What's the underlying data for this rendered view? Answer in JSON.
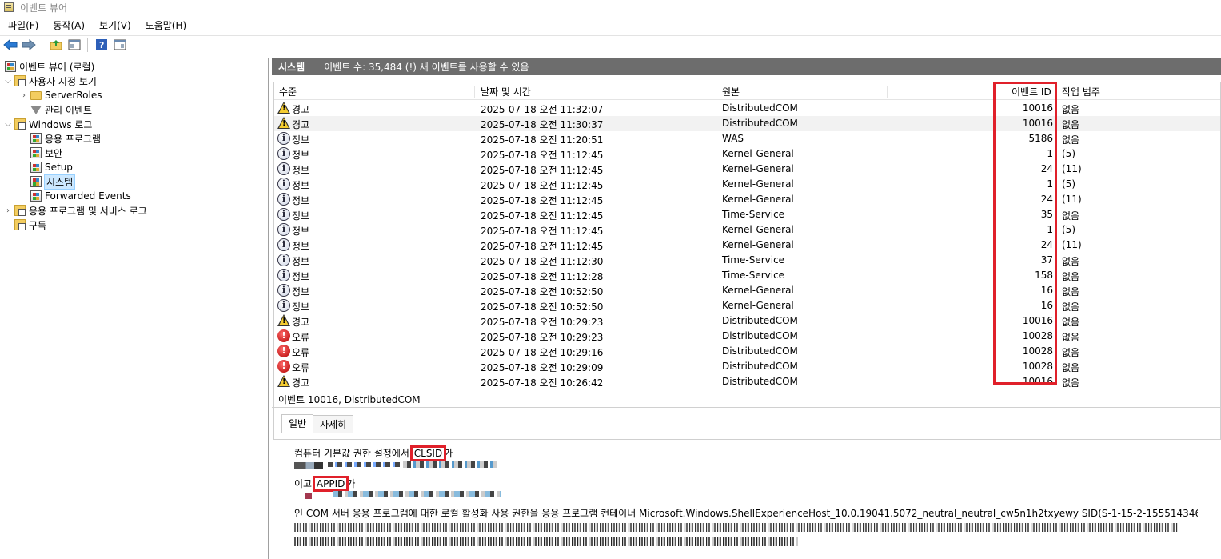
{
  "window": {
    "title": "이벤트 뷰어"
  },
  "menu": [
    "파일(F)",
    "동작(A)",
    "보기(V)",
    "도움말(H)"
  ],
  "toolbar": [
    "back-icon",
    "forward-icon",
    "up-folder-icon",
    "show-hide-console-tree-icon",
    "help-icon",
    "show-hide-action-pane-icon"
  ],
  "tree": {
    "root": "이벤트 뷰어 (로컬)",
    "custom_views": "사용자 지정 보기",
    "server_roles": "ServerRoles",
    "admin_events": "관리 이벤트",
    "windows_logs": "Windows 로그",
    "application": "응용 프로그램",
    "security": "보안",
    "setup": "Setup",
    "system": "시스템",
    "forwarded": "Forwarded Events",
    "apps_services": "응용 프로그램 및 서비스 로그",
    "subscriptions": "구독"
  },
  "header": {
    "title": "시스템",
    "count_text": "이벤트 수: 35,484 (!) 새 이벤트를 사용할 수 있음"
  },
  "columns": {
    "level": "수준",
    "datetime": "날짜 및 시간",
    "source": "원본",
    "event_id": "이벤트 ID",
    "task": "작업 범주"
  },
  "events": [
    {
      "level": "경고",
      "type": "warn",
      "datetime": "2025-07-18 오전 11:32:07",
      "source": "DistributedCOM",
      "id": "10016",
      "task": "없음"
    },
    {
      "level": "경고",
      "type": "warn",
      "datetime": "2025-07-18 오전 11:30:37",
      "source": "DistributedCOM",
      "id": "10016",
      "task": "없음"
    },
    {
      "level": "정보",
      "type": "info",
      "datetime": "2025-07-18 오전 11:20:51",
      "source": "WAS",
      "id": "5186",
      "task": "없음"
    },
    {
      "level": "정보",
      "type": "info",
      "datetime": "2025-07-18 오전 11:12:45",
      "source": "Kernel-General",
      "id": "1",
      "task": "(5)"
    },
    {
      "level": "정보",
      "type": "info",
      "datetime": "2025-07-18 오전 11:12:45",
      "source": "Kernel-General",
      "id": "24",
      "task": "(11)"
    },
    {
      "level": "정보",
      "type": "info",
      "datetime": "2025-07-18 오전 11:12:45",
      "source": "Kernel-General",
      "id": "1",
      "task": "(5)"
    },
    {
      "level": "정보",
      "type": "info",
      "datetime": "2025-07-18 오전 11:12:45",
      "source": "Kernel-General",
      "id": "24",
      "task": "(11)"
    },
    {
      "level": "정보",
      "type": "info",
      "datetime": "2025-07-18 오전 11:12:45",
      "source": "Time-Service",
      "id": "35",
      "task": "없음"
    },
    {
      "level": "정보",
      "type": "info",
      "datetime": "2025-07-18 오전 11:12:45",
      "source": "Kernel-General",
      "id": "1",
      "task": "(5)"
    },
    {
      "level": "정보",
      "type": "info",
      "datetime": "2025-07-18 오전 11:12:45",
      "source": "Kernel-General",
      "id": "24",
      "task": "(11)"
    },
    {
      "level": "정보",
      "type": "info",
      "datetime": "2025-07-18 오전 11:12:30",
      "source": "Time-Service",
      "id": "37",
      "task": "없음"
    },
    {
      "level": "정보",
      "type": "info",
      "datetime": "2025-07-18 오전 11:12:28",
      "source": "Time-Service",
      "id": "158",
      "task": "없음"
    },
    {
      "level": "정보",
      "type": "info",
      "datetime": "2025-07-18 오전 10:52:50",
      "source": "Kernel-General",
      "id": "16",
      "task": "없음"
    },
    {
      "level": "정보",
      "type": "info",
      "datetime": "2025-07-18 오전 10:52:50",
      "source": "Kernel-General",
      "id": "16",
      "task": "없음"
    },
    {
      "level": "경고",
      "type": "warn",
      "datetime": "2025-07-18 오전 10:29:23",
      "source": "DistributedCOM",
      "id": "10016",
      "task": "없음"
    },
    {
      "level": "오류",
      "type": "error",
      "datetime": "2025-07-18 오전 10:29:23",
      "source": "DistributedCOM",
      "id": "10028",
      "task": "없음"
    },
    {
      "level": "오류",
      "type": "error",
      "datetime": "2025-07-18 오전 10:29:16",
      "source": "DistributedCOM",
      "id": "10028",
      "task": "없음"
    },
    {
      "level": "오류",
      "type": "error",
      "datetime": "2025-07-18 오전 10:29:09",
      "source": "DistributedCOM",
      "id": "10028",
      "task": "없음"
    },
    {
      "level": "경고",
      "type": "warn",
      "datetime": "2025-07-18 오전 10:26:42",
      "source": "DistributedCOM",
      "id": "10016",
      "task": "없음"
    }
  ],
  "details": {
    "title": "이벤트 10016, DistributedCOM",
    "tabs": [
      "일반",
      "자세히"
    ],
    "line1_prefix": "컴퓨터 기본값 권한 설정에서 ",
    "line1_highlight": "CLSID",
    "line1_suffix": "가",
    "line2_prefix": "이고 ",
    "line2_highlight": "APPID",
    "line2_suffix": "가",
    "message": "인 COM 서버 응용 프로그램에 대한 로컬 활성화 사용 권한을 응용 프로그램 컨테이너 Microsoft.Windows.ShellExperienceHost_10.0.19041.5072_neutral_neutral_cw5n1h2txyewy SID(S-1-15-2-155514346-"
  },
  "colors": {
    "highlight_box": "#e0202a",
    "header_bar": "#6d6d6d",
    "selection": "#cce8ff"
  }
}
